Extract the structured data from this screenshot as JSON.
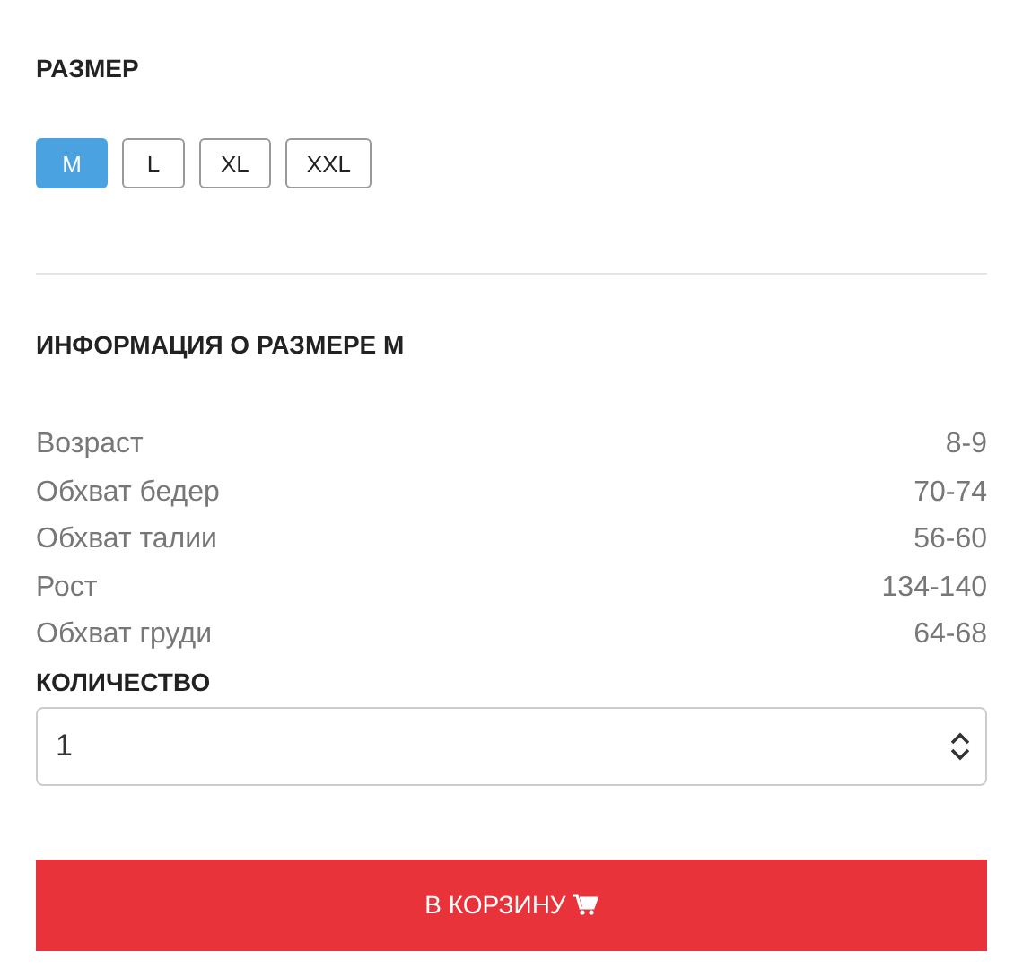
{
  "size_title": "РАЗМЕР",
  "sizes": [
    {
      "label": "M",
      "selected": true
    },
    {
      "label": "L",
      "selected": false
    },
    {
      "label": "XL",
      "selected": false
    },
    {
      "label": "XXL",
      "selected": false
    }
  ],
  "info_title": "ИНФОРМАЦИЯ О РАЗМЕРЕ M",
  "info_rows": [
    {
      "label": "Возраст",
      "value": "8-9"
    },
    {
      "label": "Обхват бедер",
      "value": "70-74"
    },
    {
      "label": "Обхват талии",
      "value": "56-60"
    },
    {
      "label": "Рост",
      "value": "134-140"
    },
    {
      "label": "Обхват груди",
      "value": "64-68"
    }
  ],
  "quantity": {
    "label": "КОЛИЧЕСТВО",
    "value": "1"
  },
  "cart_button": {
    "label": "В КОРЗИНУ"
  }
}
